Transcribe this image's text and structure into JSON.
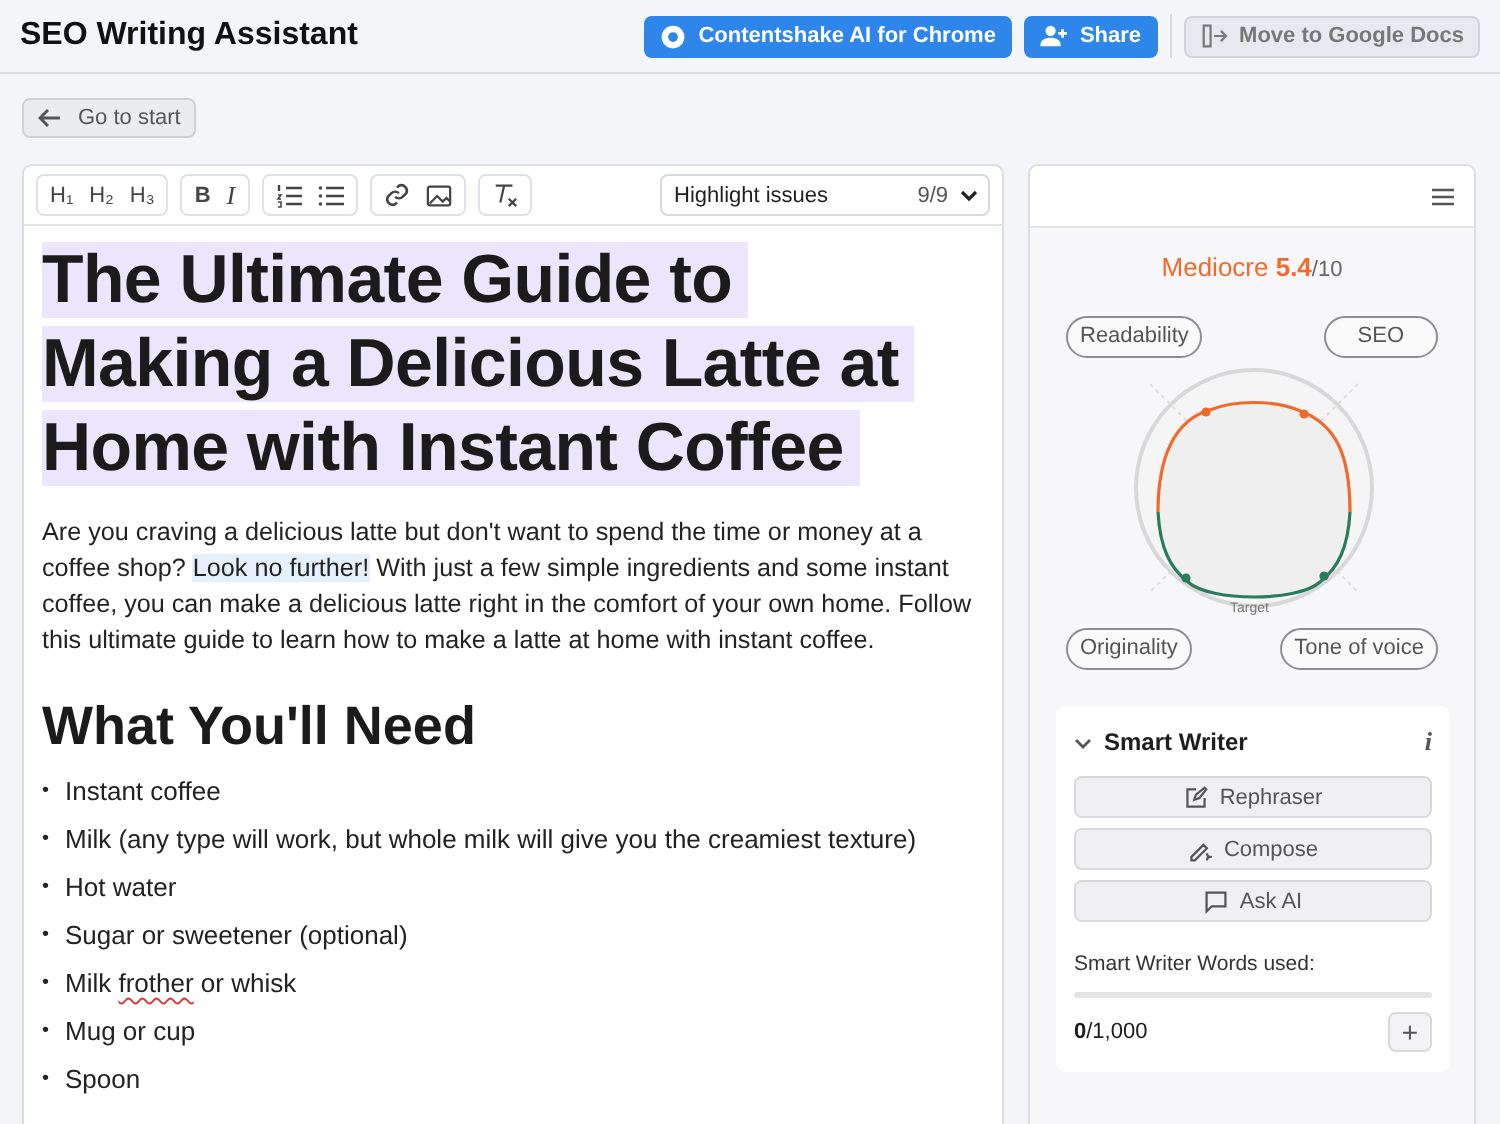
{
  "header": {
    "title": "SEO Writing Assistant",
    "buttons": [
      {
        "kind": "primary",
        "label": "Contentshake AI for Chrome"
      },
      {
        "kind": "primary",
        "label": "Share"
      },
      {
        "kind": "secondary",
        "label": "Move to Google Docs"
      }
    ]
  },
  "back_button": {
    "label": "Go to start"
  },
  "toolbar": {
    "headings": [
      "H₁",
      "H₂",
      "H₃"
    ],
    "format": [
      {
        "label": "B",
        "kind": "bold"
      },
      {
        "label": "I",
        "kind": "italic"
      }
    ],
    "highlight_select": {
      "label": "Highlight issues",
      "count": "9/9"
    }
  },
  "document": {
    "title": {
      "text": "The Ultimate Guide to Making a Delicious Latte at Home with Instant Coffee",
      "highlighted": true
    },
    "paragraph": [
      {
        "text": "Are you craving a delicious latte but don't want to spend the time or money at a coffee shop? ",
        "highlighted": false
      },
      {
        "text": "Look no further!",
        "highlighted": true
      },
      {
        "text": " With just a few simple ingredients and some instant coffee, you can make a delicious latte right in the comfort of your own home. Follow this ultimate guide to learn how to make a latte at home with instant coffee.",
        "highlighted": false
      }
    ],
    "subheading": "What You'll Need",
    "list": [
      {
        "bullet": "•",
        "segments": [
          {
            "text": "Instant coffee",
            "misspelled": false
          }
        ]
      },
      {
        "bullet": "•",
        "segments": [
          {
            "text": "Milk (any type will work, but whole milk will give you the creamiest texture)",
            "misspelled": false
          }
        ]
      },
      {
        "bullet": "•",
        "segments": [
          {
            "text": "Hot water",
            "misspelled": false
          }
        ]
      },
      {
        "bullet": "•",
        "segments": [
          {
            "text": "Sugar or sweetener (optional)",
            "misspelled": false
          }
        ]
      },
      {
        "bullet": "•",
        "segments": [
          {
            "text": "Milk ",
            "misspelled": false
          },
          {
            "text": "frother",
            "misspelled": true
          },
          {
            "text": " or whisk",
            "misspelled": false
          }
        ]
      },
      {
        "bullet": "•",
        "segments": [
          {
            "text": "Mug or cup",
            "misspelled": false
          }
        ]
      },
      {
        "bullet": "•",
        "segments": [
          {
            "text": "Spoon",
            "misspelled": false
          }
        ]
      }
    ]
  },
  "score": {
    "rating": "Mediocre",
    "value": "5.4",
    "max": "/10",
    "labels": [
      "Readability",
      "SEO",
      "Originality",
      "Tone of voice"
    ],
    "target_label": "Target"
  },
  "smart_writer": {
    "title": "Smart Writer",
    "expanded": true,
    "info": "i",
    "buttons": [
      {
        "label": "Rephraser"
      },
      {
        "label": "Compose"
      },
      {
        "label": "Ask AI"
      }
    ],
    "words_label": "Smart Writer Words used:",
    "level": 0,
    "used": "0",
    "limit": "/1,000",
    "add": "+"
  }
}
